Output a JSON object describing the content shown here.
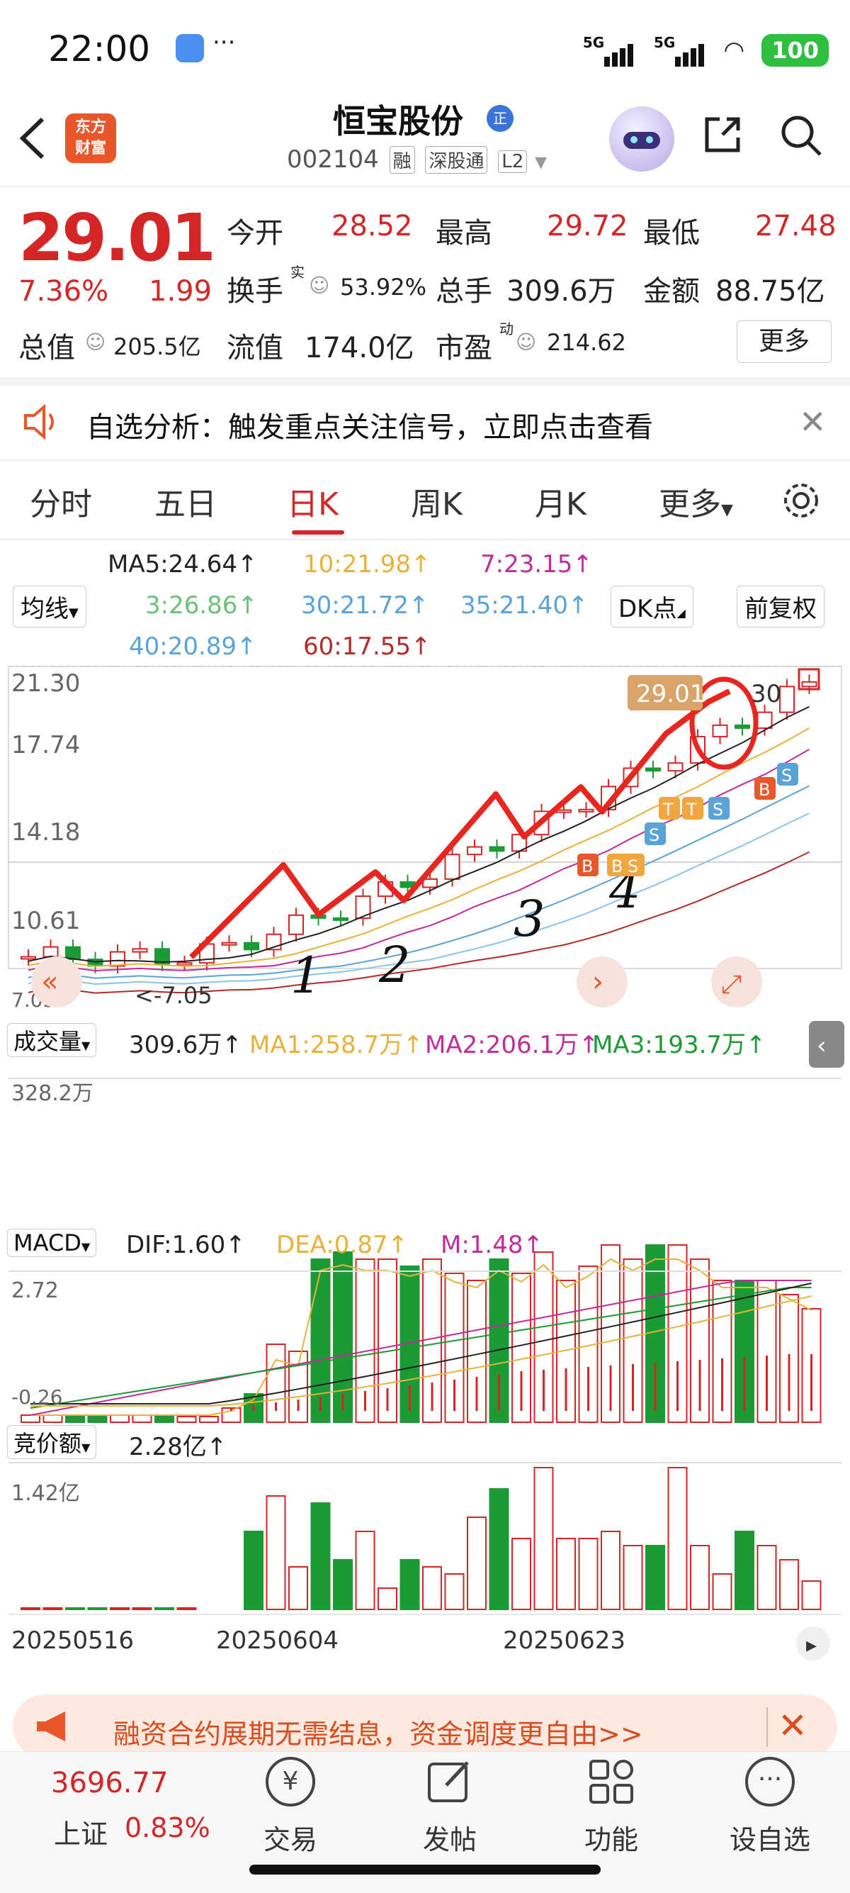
{
  "status_bar": {
    "time": "22:00",
    "net1": "5G",
    "net2": "5G",
    "battery": "100"
  },
  "header": {
    "logo_text": "东方财富",
    "stock_name": "恒宝股份",
    "stock_badge": "正",
    "code": "002104",
    "tags": [
      "融",
      "深股通",
      "L2"
    ]
  },
  "quote": {
    "price": "29.01",
    "change_pct": "7.36%",
    "change": "1.99",
    "open_label": "今开",
    "open": "28.52",
    "high_label": "最高",
    "high": "29.72",
    "low_label": "最低",
    "low": "27.48",
    "turnover_label": "换手",
    "turnover_sup": "实",
    "turnover": "53.92%",
    "volume_label": "总手",
    "volume": "309.6万",
    "amount_label": "金额",
    "amount": "88.75亿",
    "mktcap_label": "总值",
    "mktcap": "205.5亿",
    "float_label": "流值",
    "float_cap": "174.0亿",
    "pe_label": "市盈",
    "pe_sup": "动",
    "pe": "214.62",
    "more_label": "更多"
  },
  "alert": {
    "text": "自选分析：触发重点关注信号，立即点击查看"
  },
  "tabs": [
    "分时",
    "五日",
    "日K",
    "周K",
    "月K",
    "更多"
  ],
  "ma_legend": {
    "row1": [
      "MA5:24.64↑",
      "10:21.98↑",
      "7:23.15↑"
    ],
    "row2": [
      "3:26.86↑",
      "30:21.72↑",
      "35:21.40↑"
    ],
    "row3": [
      "40:20.89↑",
      "60:17.55↑"
    ],
    "ma_select": "均线",
    "dk_select": "DK点",
    "adjust": "前复权"
  },
  "kline": {
    "y_ticks": [
      "21.30",
      "17.74",
      "14.18",
      "10.61",
      "7.05"
    ],
    "last_price_tag": "29.01",
    "right_tag": "30",
    "min_label": "<-7.05",
    "signals": [
      "B",
      "T",
      "T",
      "S",
      "S",
      "B",
      "S",
      "B",
      "S"
    ],
    "annotations": [
      "1",
      "2",
      "3",
      "4"
    ]
  },
  "volume_pane": {
    "label": "成交量",
    "current": "309.6万↑",
    "ma1": "MA1:258.7万↑",
    "ma2": "MA2:206.1万↑",
    "ma3": "MA3:193.7万↑",
    "y_tick": "328.2万"
  },
  "macd_pane": {
    "label": "MACD",
    "dif": "DIF:1.60↑",
    "dea": "DEA:0.87↑",
    "m": "M:1.48↑",
    "y_top": "2.72",
    "y_bottom": "-0.26"
  },
  "auction_pane": {
    "label": "竞价额",
    "current": "2.28亿↑",
    "y_tick": "1.42亿"
  },
  "x_dates": [
    "20250516",
    "20250604",
    "20250623"
  ],
  "ad": {
    "text": "融资合约展期无需结息，资金调度更自由>>"
  },
  "bottom_nav": {
    "index_value": "3696.77",
    "index_name": "上证",
    "index_pct": "0.83%",
    "items": [
      "交易",
      "发帖",
      "功能",
      "设自选"
    ]
  },
  "colors": {
    "up": "#d42626",
    "down": "#1c9a35",
    "ma5": "#222222",
    "ma10": "#e8b23a",
    "ma_purple": "#c02c9a"
  }
}
